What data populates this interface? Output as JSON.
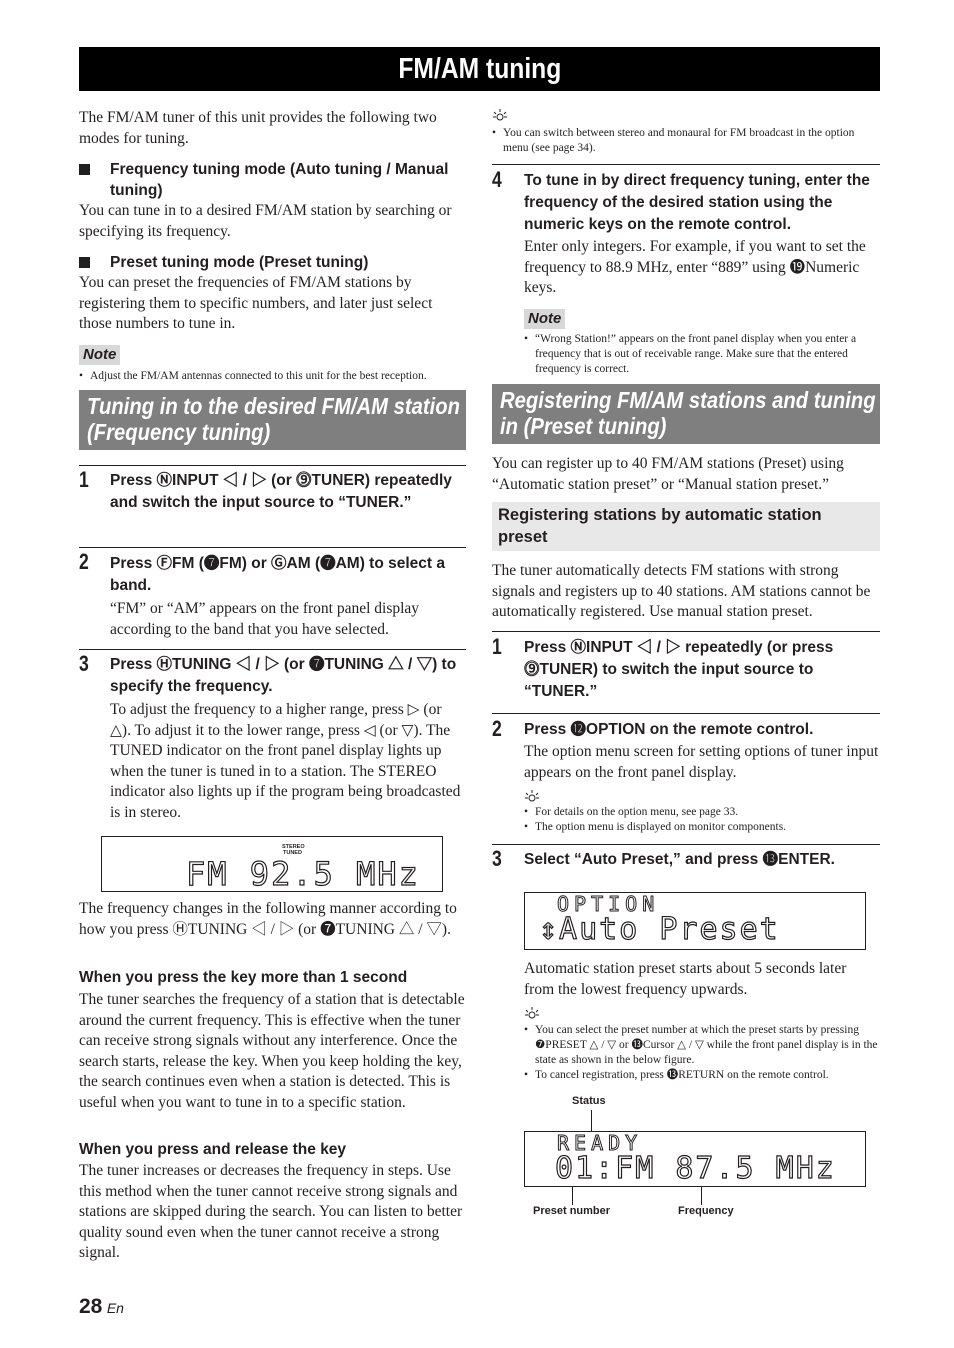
{
  "page": {
    "title": "FM/AM tuning",
    "page_number": "28",
    "page_lang": "En"
  },
  "left": {
    "intro": "The FM/AM tuner of this unit provides the following two modes for tuning.",
    "mode1_heading": "Frequency tuning mode (Auto tuning / Manual tuning)",
    "mode1_text": "You can tune in to a desired FM/AM station by searching or specifying its frequency.",
    "mode2_heading": "Preset tuning mode (Preset tuning)",
    "mode2_text": "You can preset the frequencies of FM/AM stations by registering them to specific numbers, and later just select those numbers to tune in.",
    "note_label": "Note",
    "note_text": "Adjust the FM/AM antennas connected to this unit for the best reception.",
    "section_title": "Tuning in to the desired FM/AM station (Frequency tuning)",
    "steps": [
      {
        "num": "1",
        "text": "Press ⓃINPUT ◁ / ▷ (or ⓽TUNER) repeatedly and switch the input source to “TUNER.”"
      },
      {
        "num": "2",
        "text": "Press ⒻFM (❼FM) or ⒼAM (❼AM) to select a band.",
        "body": "“FM” or “AM” appears on the front panel display according to the band that you have selected."
      },
      {
        "num": "3",
        "text": "Press ⒽTUNING ◁ / ▷ (or ❼TUNING △ / ▽) to specify the frequency.",
        "body": "To adjust the frequency to a higher range, press ▷ (or △). To adjust it to the lower range, press ◁ (or ▽). The TUNED indicator on the front panel display lights up when the tuner is tuned in to a station. The STEREO indicator also lights up if the program being broadcasted is in stereo."
      }
    ],
    "display1": {
      "indicator_top": "STEREO",
      "indicator_bottom": "TUNED",
      "text": "FM 92.5 MHz"
    },
    "freq_change_text": "The frequency changes in the following manner according to how you press ⒽTUNING ◁ / ▷ (or ❼TUNING △ / ▽).",
    "sub1_heading": "When you press the key more than 1 second",
    "sub1_text": "The tuner searches the frequency of a station that is detectable around the current frequency. This is effective when the tuner can receive strong signals without any interference. Once the search starts, release the key. When you keep holding the key, the search continues even when a station is detected. This is useful when you want to tune in to a specific station.",
    "sub2_heading": "When you press and release the key",
    "sub2_text": "The tuner increases or decreases the frequency in steps. Use this method when the tuner cannot receive strong signals and stations are skipped during the search. You can listen to better quality sound even when the tuner cannot receive a strong signal."
  },
  "right": {
    "tip1": "You can switch between stereo and monaural for FM broadcast in the option menu (see page 34).",
    "step4_num": "4",
    "step4_text": "To tune in by direct frequency tuning, enter the frequency of the desired station using the numeric keys on the remote control.",
    "step4_body": "Enter only integers. For example, if you want to set the frequency to 88.9 MHz, enter “889” using ⓳Numeric keys.",
    "note_label": "Note",
    "note_text": "“Wrong Station!” appears on the front panel display when you enter a frequency that is out of receivable range. Make sure that the entered frequency is correct.",
    "section_title": "Registering FM/AM stations and tuning in (Preset tuning)",
    "section_intro": "You can register up to 40 FM/AM stations (Preset) using “Automatic station preset” or “Manual station preset.”",
    "sub_heading": "Registering stations by automatic station preset",
    "sub_text": "The tuner automatically detects FM stations with strong signals and registers up to 40 stations. AM stations cannot be automatically registered. Use manual station preset.",
    "steps": [
      {
        "num": "1",
        "text": "Press ⓃINPUT ◁ / ▷ repeatedly (or press ⓽TUNER) to switch the input source to “TUNER.”"
      },
      {
        "num": "2",
        "text": "Press ⓬OPTION on the remote control.",
        "body": "The option menu screen for setting options of tuner input appears on the front panel display."
      },
      {
        "num": "3",
        "text": "Select “Auto Preset,” and press ⓭ENTER."
      }
    ],
    "tip2": [
      "For details on the option menu, see page 33.",
      "The option menu is displayed on monitor components."
    ],
    "display2": {
      "line1": "OPTION",
      "line2": "↕Auto Preset"
    },
    "auto_text": "Automatic station preset starts about 5 seconds later from the lowest frequency upwards.",
    "tip3": [
      "You can select the preset number at which the preset starts by pressing ❼PRESET △ / ▽ or ⓭Cursor △ / ▽ while the front panel display is in the state as shown in the below figure.",
      "To cancel registration, press ⓭RETURN on the remote control."
    ],
    "display3": {
      "line1": "READY",
      "line2": "01:FM 87.5 MHz",
      "label_status": "Status",
      "label_preset": "Preset number",
      "label_freq": "Frequency"
    }
  }
}
